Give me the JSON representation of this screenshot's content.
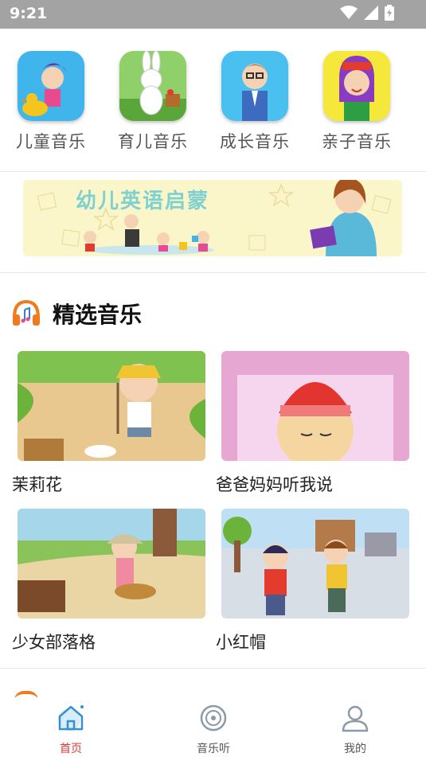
{
  "status": {
    "time": "9:21"
  },
  "categories": [
    {
      "label": "儿童音乐"
    },
    {
      "label": "育儿音乐"
    },
    {
      "label": "成长音乐"
    },
    {
      "label": "亲子音乐"
    }
  ],
  "banner": {
    "text": "幼儿英语启蒙"
  },
  "section": {
    "title": "精选音乐"
  },
  "songs": [
    {
      "title": "茉莉花"
    },
    {
      "title": "爸爸妈妈听我说"
    },
    {
      "title": "少女部落格"
    },
    {
      "title": "小红帽"
    }
  ],
  "tabs": [
    {
      "label": "首页",
      "icon": "home-icon",
      "active": true
    },
    {
      "label": "音乐听",
      "icon": "disc-icon",
      "active": false
    },
    {
      "label": "我的",
      "icon": "user-icon",
      "active": false
    }
  ],
  "colors": {
    "accent": "#e3352f",
    "status_bar": "#a3a3a3"
  }
}
